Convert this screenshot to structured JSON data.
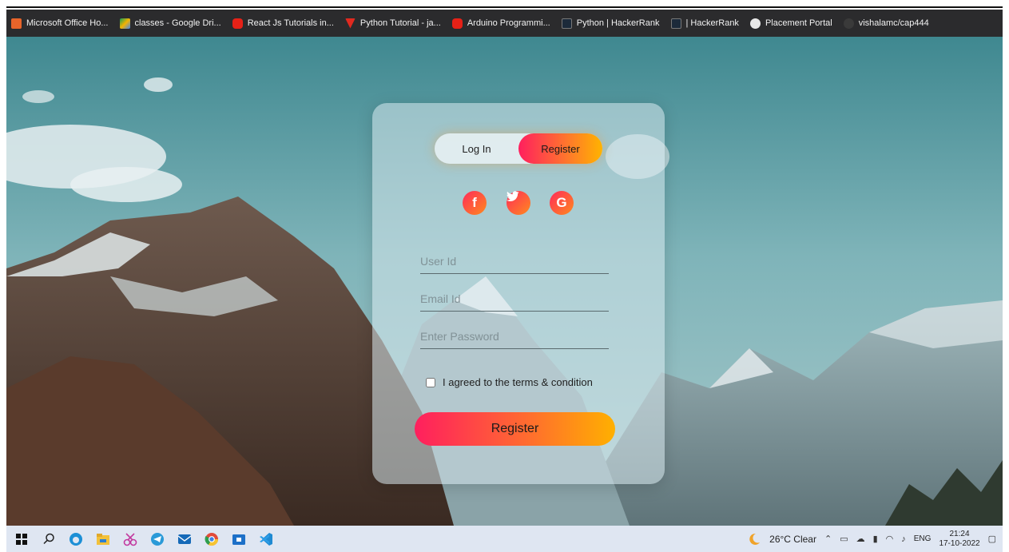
{
  "bookmarks": [
    {
      "label": "Microsoft Office Ho...",
      "icon": "office-icon",
      "color": "#e8642a"
    },
    {
      "label": "classes - Google Dri...",
      "icon": "google-drive-icon",
      "color": "#f4b400"
    },
    {
      "label": "React Js Tutorials in...",
      "icon": "youtube-icon",
      "color": "#e62117"
    },
    {
      "label": "Python Tutorial - ja...",
      "icon": "javatpoint-icon",
      "color": "#e0291f"
    },
    {
      "label": "Arduino Programmi...",
      "icon": "youtube-icon",
      "color": "#e62117"
    },
    {
      "label": "Python | HackerRank",
      "icon": "hackerrank-icon",
      "color": "#1c2a3a"
    },
    {
      "label": "| HackerRank",
      "icon": "hackerrank-icon",
      "color": "#1c2a3a"
    },
    {
      "label": "Placement Portal",
      "icon": "globe-icon",
      "color": "#e8e8e8"
    },
    {
      "label": "vishalamc/cap444",
      "icon": "github-icon",
      "color": "#3a3a3a"
    }
  ],
  "auth": {
    "tabs": {
      "login": "Log In",
      "register": "Register",
      "active": "register"
    },
    "social": [
      {
        "name": "facebook",
        "glyph": "f"
      },
      {
        "name": "twitter",
        "glyph": "t"
      },
      {
        "name": "google",
        "glyph": "G"
      }
    ],
    "fields": {
      "user_id_placeholder": "User Id",
      "email_placeholder": "Email Id",
      "password_placeholder": "Enter Password"
    },
    "terms_label": "I agreed to the terms & condition",
    "terms_checked": false,
    "submit_label": "Register"
  },
  "taskbar": {
    "apps": [
      "windows-start-icon",
      "search-icon",
      "edge-icon",
      "file-explorer-icon",
      "snipping-tool-icon",
      "telegram-icon",
      "mail-icon",
      "chrome-icon",
      "store-icon",
      "vscode-icon"
    ],
    "weather": "26°C Clear",
    "language": "ENG",
    "time": "21:24",
    "date": "17-10-2022"
  },
  "colors": {
    "accent_start": "#ff1f5e",
    "accent_end": "#ffb000",
    "bookmark_bar": "#2b2b2d",
    "taskbar": "#dfe6f2"
  }
}
